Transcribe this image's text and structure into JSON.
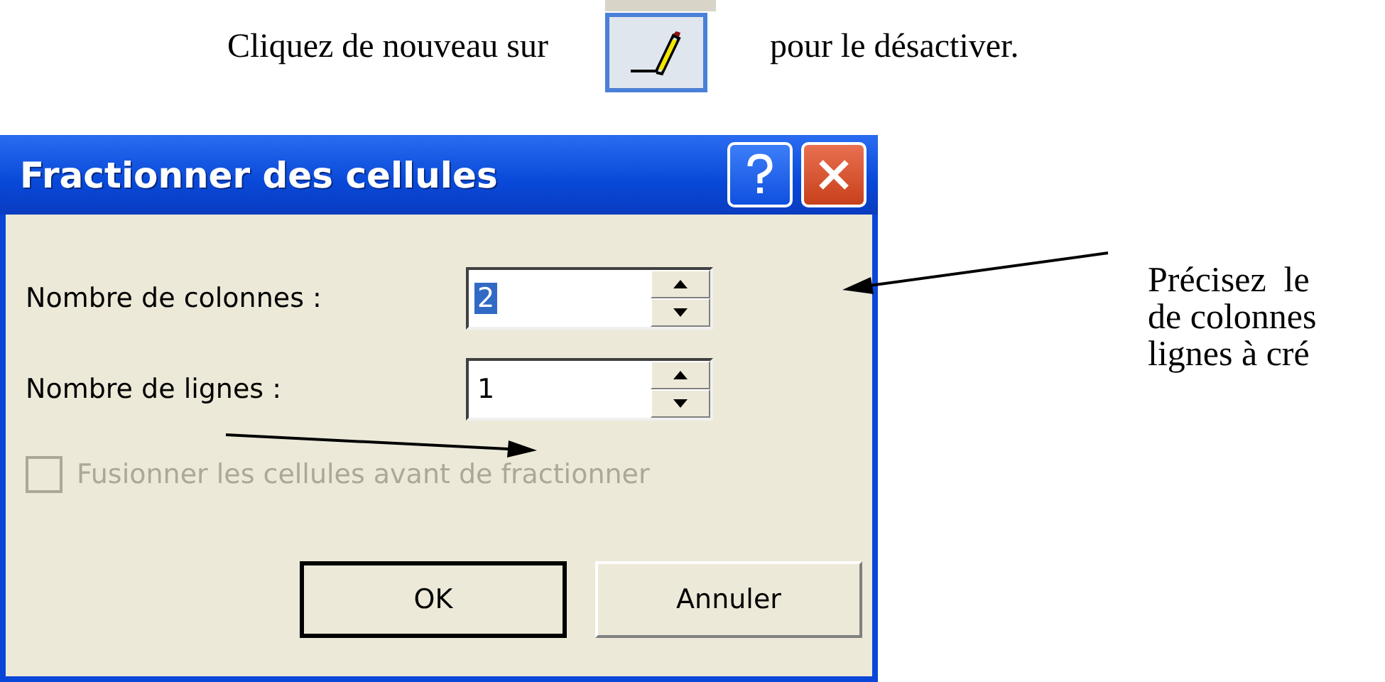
{
  "instruction": {
    "before": "Cliquez de nouveau sur",
    "after": "pour le désactiver."
  },
  "dialog": {
    "title": "Fractionner des cellules",
    "fields": [
      {
        "label": "Nombre de colonnes :",
        "value": "2",
        "value_selected": true
      },
      {
        "label": "Nombre de lignes :",
        "value": "1",
        "value_selected": false
      }
    ],
    "checkbox": {
      "label": "Fusionner les cellules avant de fractionner",
      "checked": false,
      "disabled": true
    },
    "buttons": [
      {
        "label": "OK",
        "default": true
      },
      {
        "label": "Annuler",
        "default": false
      }
    ]
  },
  "callout": {
    "lines": [
      "Précisez  le",
      "de colonnes",
      "lignes à cré"
    ]
  }
}
